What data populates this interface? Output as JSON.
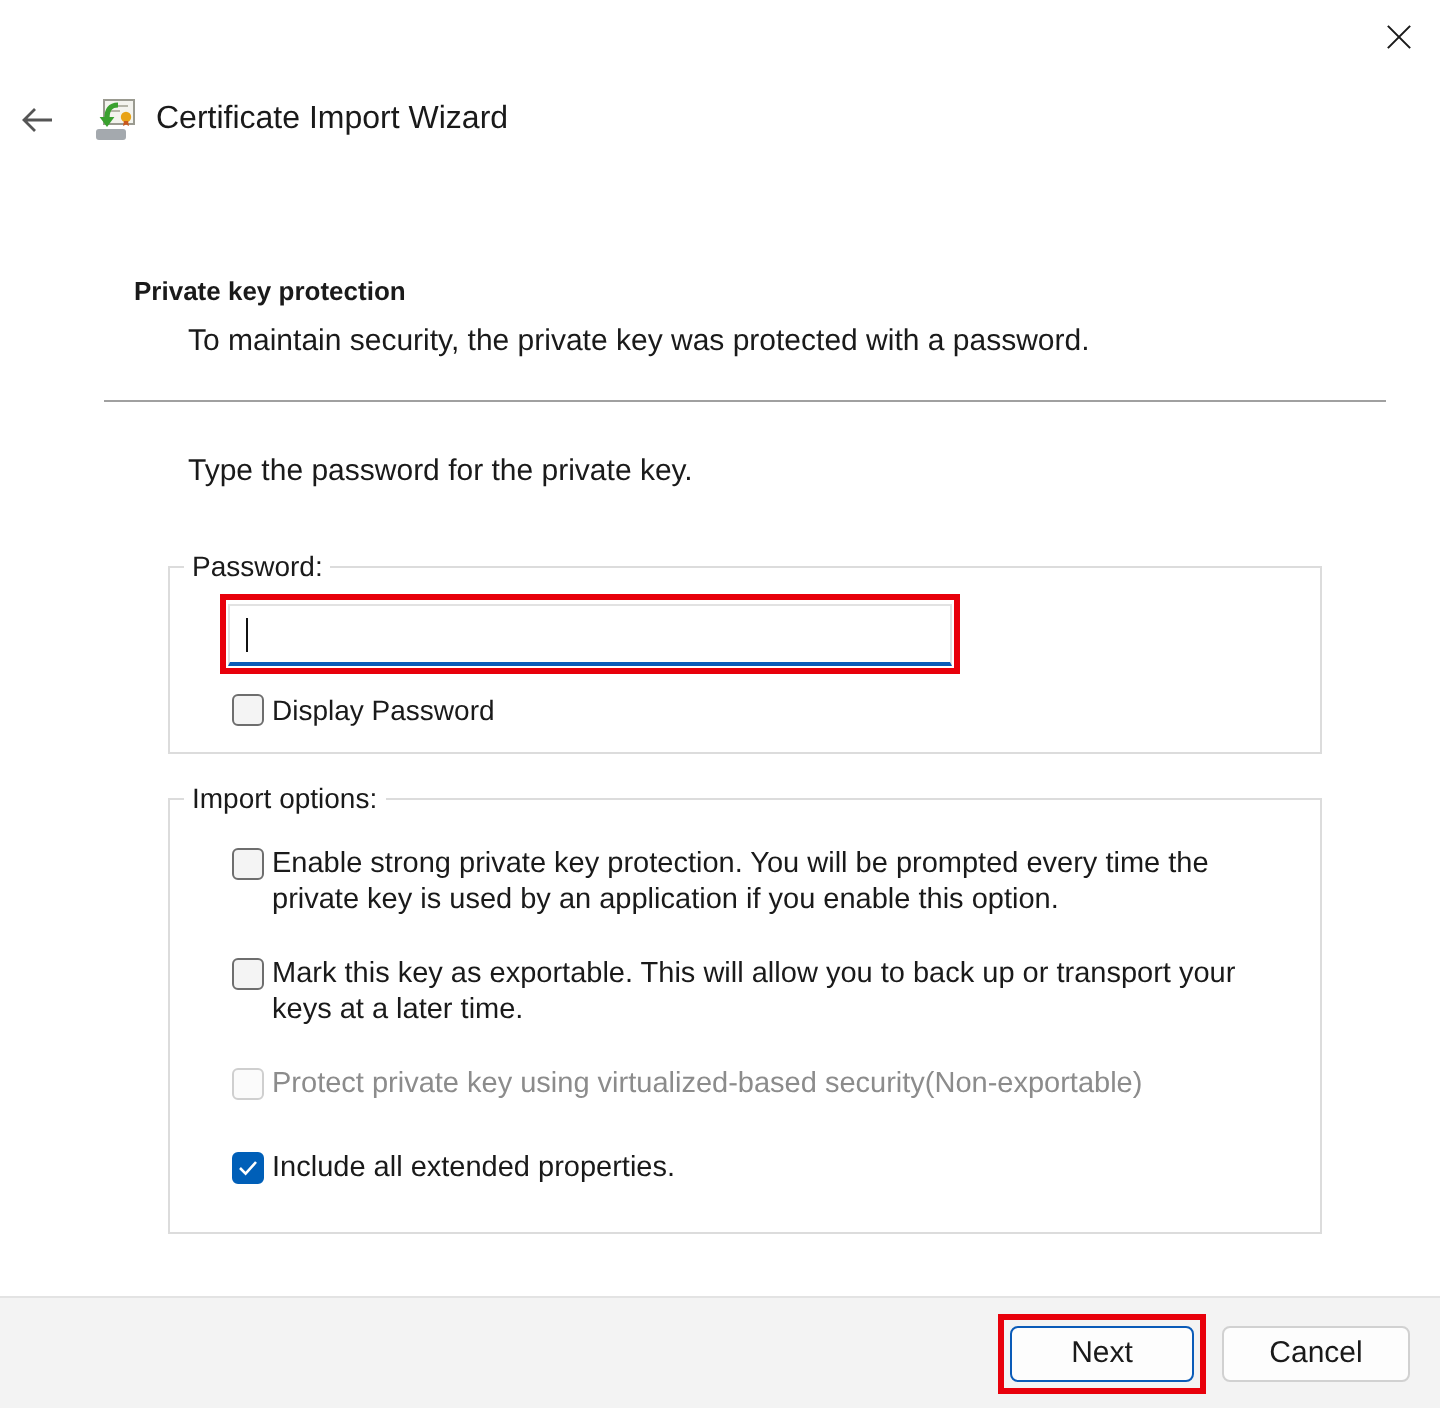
{
  "window": {
    "title": "Certificate Import Wizard"
  },
  "header": {
    "heading": "Private key protection",
    "description": "To maintain security, the private key was protected with a password."
  },
  "prompt": "Type the password for the private key.",
  "password_group": {
    "legend": "Password:",
    "field": {
      "focused": true,
      "highlighted": true
    },
    "display_password": {
      "label": "Display Password",
      "checked": false
    }
  },
  "import_options": {
    "legend": "Import options:",
    "options": [
      {
        "label": "Enable strong private key protection. You will be prompted every time the private key is used by an application if you enable this option.",
        "checked": false,
        "disabled": false
      },
      {
        "label": "Mark this key as exportable. This will allow you to back up or transport your keys at a later time.",
        "checked": false,
        "disabled": false
      },
      {
        "label": "Protect private key using virtualized-based security(Non-exportable)",
        "checked": false,
        "disabled": true
      },
      {
        "label": "Include all extended properties.",
        "checked": true,
        "disabled": false
      }
    ]
  },
  "buttons": [
    {
      "label": "Next",
      "default": true,
      "highlighted": true
    },
    {
      "label": "Cancel",
      "default": false,
      "highlighted": false
    }
  ]
}
